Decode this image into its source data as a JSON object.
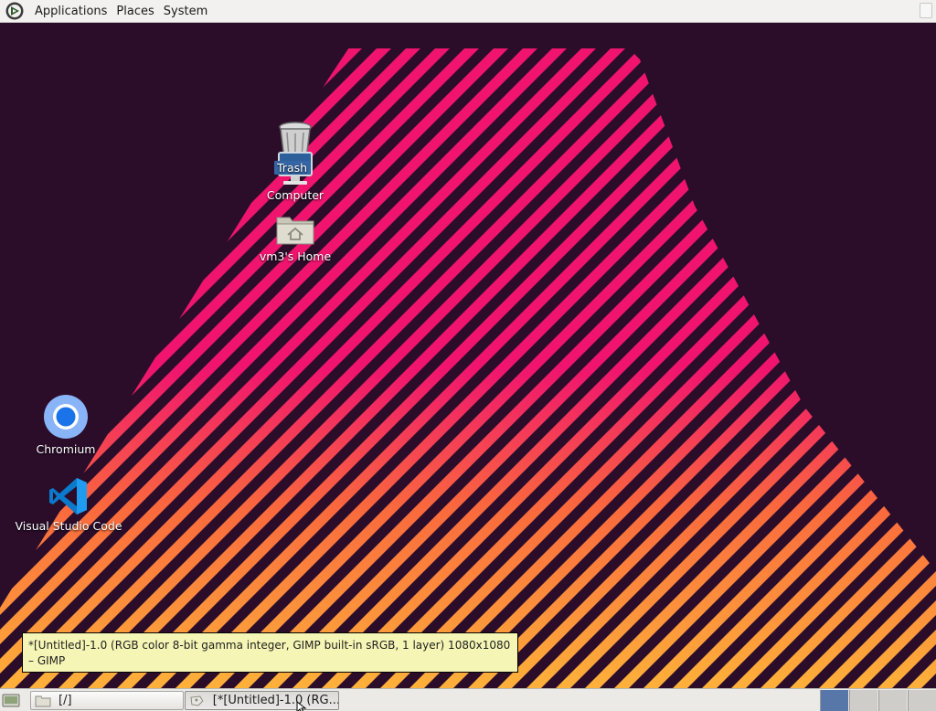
{
  "top_panel": {
    "menus": [
      "Applications",
      "Places",
      "System"
    ]
  },
  "desktop": {
    "icons": {
      "trash": "Trash",
      "computer": "Computer",
      "home": "vm3's Home",
      "chromium": "Chromium",
      "vscode": "Visual Studio Code"
    }
  },
  "tooltip": {
    "text": "*[Untitled]-1.0 (RGB color 8-bit gamma integer, GIMP built-in sRGB, 1 layer) 1080x1080 – GIMP"
  },
  "bottom_panel": {
    "tasks": [
      {
        "label": "[/]",
        "icon": "folder-icon"
      },
      {
        "label": "[*[Untitled]-1.0 (RG...",
        "icon": "gimp-icon"
      }
    ],
    "workspaces": {
      "count": 4,
      "active": 1
    }
  },
  "colors": {
    "wallpaper_bg": "#2b0d2a",
    "stripe_pink": "#f0146e",
    "stripe_orange": "#fa6a3c",
    "stripe_yellow": "#ffb23a",
    "tooltip_bg": "#f5f5b5",
    "workspace_active": "#5677a7"
  }
}
